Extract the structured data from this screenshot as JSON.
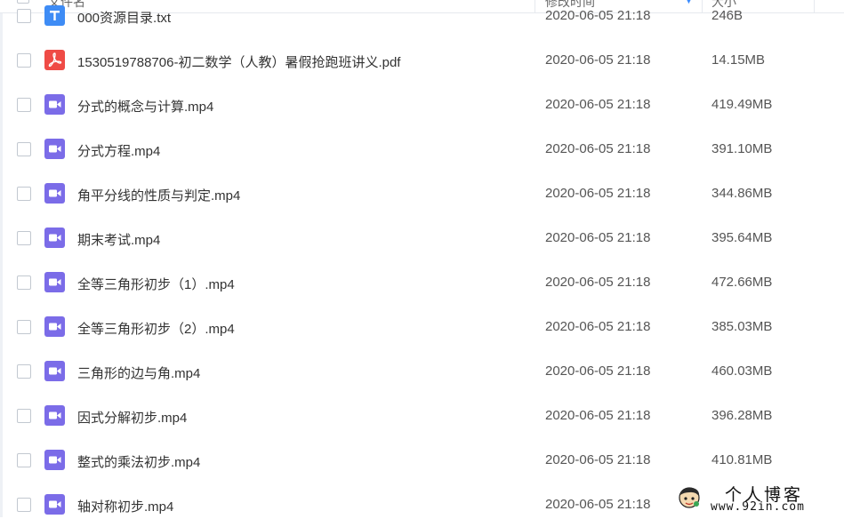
{
  "header": {
    "col_name": "文件名",
    "col_modified": "修改时间",
    "col_size": "大小"
  },
  "files": [
    {
      "name": "000资源目录.txt",
      "date": "2020-06-05 21:18",
      "size": "246B",
      "icon": "txt-file-icon"
    },
    {
      "name": "1530519788706-初二数学（人教）暑假抢跑班讲义.pdf",
      "date": "2020-06-05 21:18",
      "size": "14.15MB",
      "icon": "pdf-file-icon"
    },
    {
      "name": "分式的概念与计算.mp4",
      "date": "2020-06-05 21:18",
      "size": "419.49MB",
      "icon": "video-file-icon"
    },
    {
      "name": "分式方程.mp4",
      "date": "2020-06-05 21:18",
      "size": "391.10MB",
      "icon": "video-file-icon"
    },
    {
      "name": "角平分线的性质与判定.mp4",
      "date": "2020-06-05 21:18",
      "size": "344.86MB",
      "icon": "video-file-icon"
    },
    {
      "name": "期末考试.mp4",
      "date": "2020-06-05 21:18",
      "size": "395.64MB",
      "icon": "video-file-icon"
    },
    {
      "name": "全等三角形初步（1）.mp4",
      "date": "2020-06-05 21:18",
      "size": "472.66MB",
      "icon": "video-file-icon"
    },
    {
      "name": "全等三角形初步（2）.mp4",
      "date": "2020-06-05 21:18",
      "size": "385.03MB",
      "icon": "video-file-icon"
    },
    {
      "name": "三角形的边与角.mp4",
      "date": "2020-06-05 21:18",
      "size": "460.03MB",
      "icon": "video-file-icon"
    },
    {
      "name": "因式分解初步.mp4",
      "date": "2020-06-05 21:18",
      "size": "396.28MB",
      "icon": "video-file-icon"
    },
    {
      "name": "整式的乘法初步.mp4",
      "date": "2020-06-05 21:18",
      "size": "410.81MB",
      "icon": "video-file-icon"
    },
    {
      "name": "轴对称初步.mp4",
      "date": "2020-06-05 21:18",
      "size": "",
      "icon": "video-file-icon"
    }
  ],
  "watermark": {
    "title": "个人博客",
    "url": "www.92in.com"
  },
  "colors": {
    "video_icon": "#7b6ce8",
    "pdf_icon": "#ef4b46",
    "txt_icon": "#3e8cf5"
  }
}
